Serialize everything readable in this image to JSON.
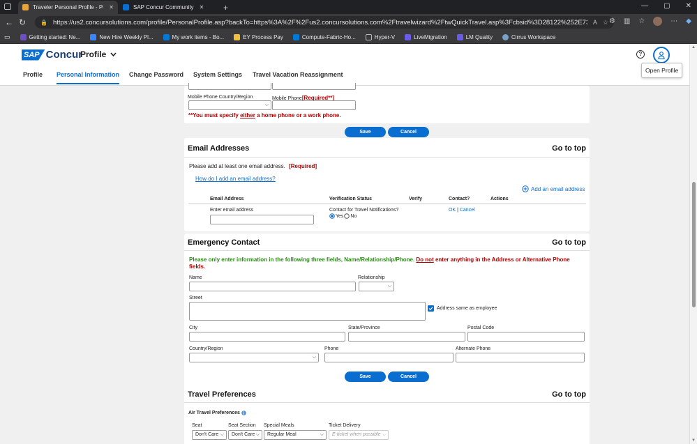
{
  "browser": {
    "tabs": [
      {
        "title": "Traveler Personal Profile - Personal",
        "active": true,
        "favicon_color": "#e8a33a"
      },
      {
        "title": "SAP Concur Community",
        "active": false,
        "favicon_color": "#0a6ed1"
      }
    ],
    "url": "https://us2.concursolutions.com/profile/PersonalProfile.asp?backTo=https%3A%2F%2Fus2.concursolutions.com%2Ftravelwizard%2FtwQuickTravel.asp%3Fcbsid%3D28122%252E73%26HTTP_REFERER%3D%2...",
    "bookmarks": [
      {
        "label": "Getting started: Ne...",
        "color": "#6c4fc2"
      },
      {
        "label": "New Hire Weekly Pl...",
        "color": "#3a86ff"
      },
      {
        "label": "My work items - Bo...",
        "color": "#0078d4"
      },
      {
        "label": "EY Process Pay",
        "color": "#f0c040"
      },
      {
        "label": "Compute-Fabric-Ho...",
        "color": "#0078d4"
      },
      {
        "label": "Hyper-V",
        "color": "#777777"
      },
      {
        "label": "LiveMigration",
        "color": "#6b5ce7"
      },
      {
        "label": "LM Quality",
        "color": "#6b5ce7"
      },
      {
        "label": "Cirrus Workspace",
        "color": "#7aa0c8"
      }
    ]
  },
  "header": {
    "brand_sap": "SAP",
    "brand_name": "Concur",
    "menu": "Profile",
    "tooltip": "Open Profile",
    "subnav": [
      "Profile",
      "Personal Information",
      "Change Password",
      "System Settings",
      "Travel Vacation Reassignment"
    ],
    "active_subnav": "Personal Information"
  },
  "phone_section": {
    "mobile_country_label": "Mobile Phone Country/Region",
    "mobile_phone_label": "Mobile Phone",
    "mobile_required": "[Required**]",
    "warning_pre": "**You must specify ",
    "warning_em": "either",
    "warning_post": " a home phone or a work phone.",
    "save": "Save",
    "cancel": "Cancel"
  },
  "email_section": {
    "title": "Email Addresses",
    "goto": "Go to top",
    "instruction": "Please add at least one email address.",
    "required": "[Required]",
    "help_link": "How do I add an email address?",
    "add_link": "Add an email address",
    "columns": [
      "Email Address",
      "Verification Status",
      "Verify",
      "Contact?",
      "Actions"
    ],
    "enter_label": "Enter email address",
    "contact_label": "Contact for Travel Notifications?",
    "yes": "Yes",
    "no": "No",
    "ok": "OK",
    "sep": "|",
    "cancel": "Cancel"
  },
  "emergency_section": {
    "title": "Emergency Contact",
    "goto": "Go to top",
    "notice_green": "Please only enter information in the following three fields, Name/Relationship/Phone.",
    "notice_do_not": "Do not",
    "notice_red": "enter anything in the Address or Alternative Phone fields.",
    "name_label": "Name",
    "relationship_label": "Relationship",
    "street_label": "Street",
    "same_address": "Address same as employee",
    "city_label": "City",
    "state_label": "State/Province",
    "postal_label": "Postal Code",
    "country_label": "Country/Region",
    "phone_label": "Phone",
    "alt_phone_label": "Alternate Phone",
    "save": "Save",
    "cancel": "Cancel"
  },
  "travel_section": {
    "title": "Travel Preferences",
    "goto": "Go to top",
    "air_label": "Air Travel Preferences",
    "seat_label": "Seat",
    "seat_section_label": "Seat Section",
    "meals_label": "Special Meals",
    "ticket_label": "Ticket Delivery",
    "seat_value": "Don't Care",
    "seat_section_value": "Don't Care",
    "meals_value": "Regular Meal",
    "ticket_value": "E-ticket when possible"
  },
  "colors": {
    "accent": "#0a6ed1",
    "required_red": "#b00000",
    "notice_green": "#2b8a16"
  }
}
